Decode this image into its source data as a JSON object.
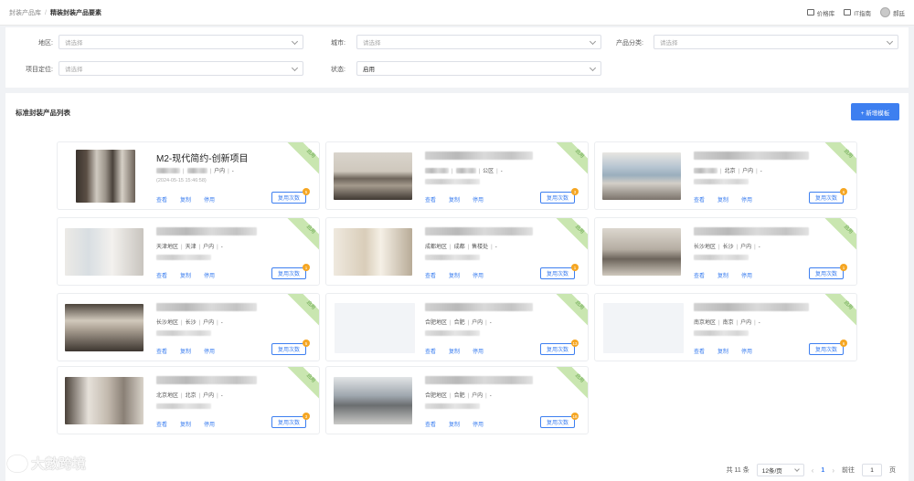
{
  "breadcrumb": {
    "root": "封装产品库",
    "current": "精装封装产品要素"
  },
  "header": {
    "action1": "价格库",
    "action2": "IT指南",
    "user": "郝廷"
  },
  "filters": {
    "region": {
      "label": "地区:",
      "placeholder": "请选择"
    },
    "city": {
      "label": "城市:",
      "placeholder": "请选择"
    },
    "category": {
      "label": "产品分类:",
      "placeholder": "请选择"
    },
    "positioning": {
      "label": "项目定位:",
      "placeholder": "请选择"
    },
    "status": {
      "label": "状态:",
      "value": "启用"
    }
  },
  "list": {
    "title": "标准封装产品列表",
    "add_button": "+ 新增模板"
  },
  "cards": [
    {
      "title": "M2-现代简约-创新项目",
      "region": "",
      "city": "",
      "type": "户内",
      "date": "(2024-05-15 15:46:58)",
      "status": "启用",
      "count": "5"
    },
    {
      "title": "",
      "region": "",
      "city": "",
      "type": "公区",
      "date": "",
      "status": "启用",
      "count": "3"
    },
    {
      "title": "",
      "region": "",
      "city": "北京",
      "type": "户内",
      "date": "",
      "status": "启用",
      "count": "6"
    },
    {
      "title": "",
      "region": "天津地区",
      "city": "天津",
      "type": "户内",
      "date": "",
      "status": "启用",
      "count": "1"
    },
    {
      "title": "",
      "region": "成都地区",
      "city": "成都",
      "type": "售楼处",
      "date": "",
      "status": "启用",
      "count": "1"
    },
    {
      "title": "",
      "region": "长沙地区",
      "city": "长沙",
      "type": "户内",
      "date": "",
      "status": "启用",
      "count": "1"
    },
    {
      "title": "",
      "region": "长沙地区",
      "city": "长沙",
      "type": "户内",
      "date": "",
      "status": "启用",
      "count": "5"
    },
    {
      "title": "",
      "region": "合肥地区",
      "city": "合肥",
      "type": "户内",
      "date": "",
      "status": "启用",
      "count": "13"
    },
    {
      "title": "",
      "region": "南京地区",
      "city": "南京",
      "type": "户内",
      "date": "",
      "status": "启用",
      "count": "6"
    },
    {
      "title": "",
      "region": "北京地区",
      "city": "北京",
      "type": "户内",
      "date": "",
      "status": "启用",
      "count": "3"
    },
    {
      "title": "",
      "region": "合肥地区",
      "city": "合肥",
      "type": "户内",
      "date": "",
      "status": "启用",
      "count": "18"
    }
  ],
  "card_actions": {
    "view": "查看",
    "copy": "复制",
    "disable": "停用",
    "reuse": "复用次数"
  },
  "pagination": {
    "total": "共 11 条",
    "page_size": "12条/页",
    "current": "1",
    "goto_prefix": "前往",
    "goto_value": "1",
    "goto_suffix": "页"
  },
  "watermark": "大數跨境",
  "colors": {
    "primary": "#3d7ff0",
    "ribbon": "#c9e6b0",
    "badge": "#f5a623"
  }
}
